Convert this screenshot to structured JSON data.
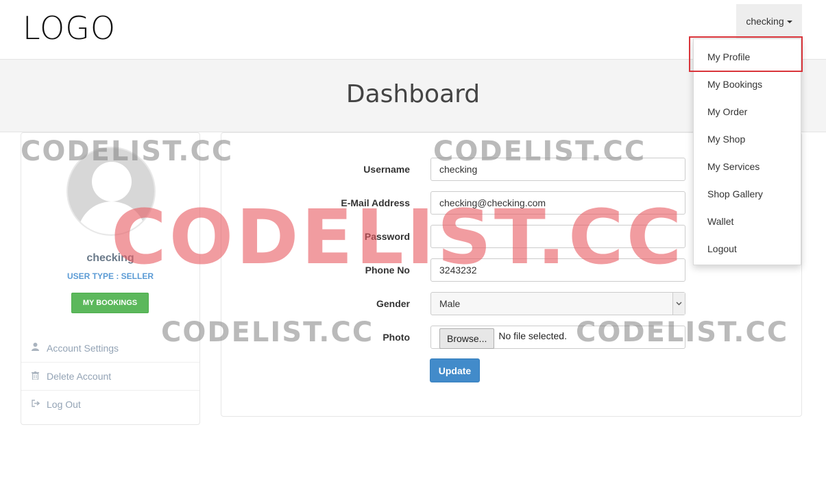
{
  "header": {
    "logo": "LOGO",
    "user_menu_label": "checking"
  },
  "banner": {
    "title": "Dashboard"
  },
  "sidebar": {
    "profile_name": "checking",
    "user_type": "USER TYPE : SELLER",
    "bookings_button": "MY BOOKINGS",
    "menu": [
      {
        "label": "Account Settings",
        "icon": "user-icon"
      },
      {
        "label": "Delete Account",
        "icon": "trash-icon"
      },
      {
        "label": "Log Out",
        "icon": "sign-out-icon"
      }
    ]
  },
  "form": {
    "username_label": "Username",
    "username_value": "checking",
    "email_label": "E-Mail Address",
    "email_value": "checking@checking.com",
    "password_label": "Password",
    "password_value": "",
    "phone_label": "Phone No",
    "phone_value": "3243232",
    "gender_label": "Gender",
    "gender_value": "Male",
    "photo_label": "Photo",
    "browse_label": "Browse...",
    "no_file_text": "No file selected.",
    "update_button": "Update"
  },
  "dropdown": {
    "items": [
      {
        "label": "My Profile"
      },
      {
        "label": "My Bookings"
      },
      {
        "label": "My Order"
      },
      {
        "label": "My Shop"
      },
      {
        "label": "My Services"
      },
      {
        "label": "Shop Gallery"
      },
      {
        "label": "Wallet"
      },
      {
        "label": "Logout"
      }
    ],
    "highlighted_item": "My Profile",
    "highlight_color": "#d9343a"
  },
  "watermark": {
    "text": "CODELIST.CC",
    "big_color": "#e85a60"
  },
  "colors": {
    "success_button": "#5cb85c",
    "primary_button": "#428bca",
    "user_type_text": "#5b9bd5"
  }
}
